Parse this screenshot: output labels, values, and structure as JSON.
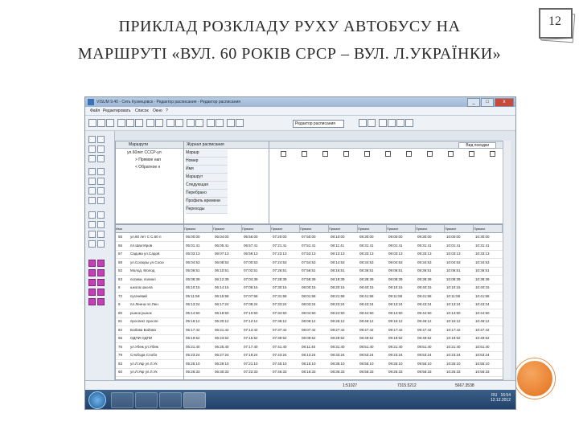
{
  "slide": {
    "title_line1": "ПРИКЛАД РОЗКЛАДУ РУХУ АВТОБУСУ НА",
    "title_line2": "МАРШРУТІ «ВУЛ. 60 РОКІВ СРСР – ВУЛ. Л.УКРАЇНКИ»",
    "page_number": "12"
  },
  "app": {
    "window_title": "VISUM 9.40 - Сеть Кузнецовск - Редактор расписания - Редактор расписания",
    "menu": [
      "Файл",
      "Редактировать",
      "Список",
      "Окно",
      "?"
    ],
    "toolbar_select": "Редактор расписания"
  },
  "tree": {
    "header": "Маршрути",
    "items": [
      "ул.60лет СССР-ул",
      "> Прямое нап",
      "< Обратное н"
    ]
  },
  "journal": {
    "header": "Журнал расписания",
    "rows": [
      "Маршр",
      "Номер",
      "Имя",
      "Маршрут",
      "Следующая",
      "Перебрано",
      "Профиль времени",
      "Переходы"
    ]
  },
  "top_grid": {
    "right_select": "Вид поездки"
  },
  "table": {
    "headers": [
      "Имя",
      "Прямое",
      "Прямое",
      "Прямое",
      "Прямое",
      "Прямое",
      "Прямое",
      "Прямое",
      "Прямое",
      "Прямое",
      "Прямое",
      "Прямое"
    ],
    "left_rows": [
      [
        "55",
        "ул.60 лет С С.60 л"
      ],
      [
        "56",
        "пл.Шахтёров"
      ],
      [
        "57",
        "Садова ул.Садов"
      ],
      [
        "58",
        "ул.Сосюры ул.Сосю"
      ],
      [
        "52",
        "Молод. Молод"
      ],
      [
        "53",
        "полики. поликл"
      ],
      [
        "8",
        "школа школа"
      ],
      [
        "72",
        "пугачевий"
      ],
      [
        "9",
        "пл.Ленна пл.Лен"
      ],
      [
        "80",
        "рынок рынок"
      ],
      [
        "81",
        "проспект проспе"
      ],
      [
        "82",
        "Бойова Бойова"
      ],
      [
        "55",
        "ОДПИ ОДПИ"
      ],
      [
        "76",
        "ул.Убеж ул.Убеж"
      ],
      [
        "79",
        "Слобода Слобо"
      ],
      [
        "83",
        "ул.Л.Укр ул.Л.Ук"
      ],
      [
        "60",
        "ул.Л.Укр ул.Л.Ук"
      ]
    ],
    "rows": [
      [
        "05:00:00",
        "06:04:00",
        "06:56:00",
        "07:20:00",
        "07:50:00",
        "08:10:00",
        "08:30:00",
        "09:00:00",
        "09:30:00",
        "10:00:00",
        "10:30:00"
      ],
      [
        "05:01:41",
        "06:05:41",
        "06:57:41",
        "07:21:41",
        "07:51:41",
        "08:11:41",
        "08:31:41",
        "09:01:41",
        "09:31:41",
        "10:01:41",
        "10:31:41"
      ],
      [
        "05:03:13",
        "06:07:13",
        "06:59:13",
        "07:23:13",
        "07:53:13",
        "08:13:13",
        "08:33:13",
        "09:03:13",
        "09:33:13",
        "10:03:13",
        "10:33:13"
      ],
      [
        "05:04:53",
        "06:08:53",
        "07:00:53",
        "07:24:53",
        "07:54:53",
        "08:14:53",
        "08:34:53",
        "09:04:53",
        "09:34:53",
        "10:04:53",
        "10:34:53"
      ],
      [
        "05:06:51",
        "06:10:51",
        "07:02:51",
        "07:26:51",
        "07:56:51",
        "08:16:51",
        "08:36:51",
        "09:06:51",
        "09:36:51",
        "10:06:51",
        "10:36:51"
      ],
      [
        "05:08:39",
        "06:12:39",
        "07:04:39",
        "07:28:39",
        "07:58:39",
        "08:18:39",
        "08:38:39",
        "09:08:39",
        "09:38:39",
        "10:08:39",
        "10:38:39"
      ],
      [
        "05:10:15",
        "06:14:15",
        "07:06:15",
        "07:30:15",
        "08:00:15",
        "08:20:15",
        "08:40:15",
        "09:10:15",
        "09:40:15",
        "10:10:15",
        "10:40:15"
      ],
      [
        "05:11:58",
        "06:15:58",
        "07:07:58",
        "07:31:58",
        "08:01:58",
        "08:21:58",
        "08:41:58",
        "09:11:58",
        "09:41:58",
        "10:11:58",
        "10:41:58"
      ],
      [
        "05:13:24",
        "06:17:24",
        "07:09:24",
        "07:33:24",
        "08:03:24",
        "08:23:24",
        "08:43:24",
        "09:13:24",
        "09:43:24",
        "10:13:24",
        "10:43:24"
      ],
      [
        "05:14:50",
        "06:18:50",
        "07:10:50",
        "07:34:50",
        "08:04:50",
        "08:24:50",
        "08:44:50",
        "09:14:50",
        "09:44:50",
        "10:14:50",
        "10:44:50"
      ],
      [
        "05:16:12",
        "06:20:12",
        "07:12:12",
        "07:36:12",
        "08:06:12",
        "08:26:12",
        "08:46:12",
        "09:16:12",
        "09:46:12",
        "10:16:12",
        "10:46:12"
      ],
      [
        "05:17:42",
        "06:21:42",
        "07:13:42",
        "07:37:42",
        "08:07:42",
        "08:27:42",
        "08:47:42",
        "09:17:42",
        "09:47:42",
        "10:17:42",
        "10:47:42"
      ],
      [
        "05:19:52",
        "06:23:52",
        "07:15:52",
        "07:39:52",
        "08:09:52",
        "08:29:52",
        "08:49:52",
        "09:19:52",
        "09:49:52",
        "10:19:52",
        "10:49:52"
      ],
      [
        "05:21:40",
        "06:25:40",
        "07:17:40",
        "07:41:40",
        "08:11:40",
        "08:31:40",
        "08:51:40",
        "09:21:40",
        "09:51:40",
        "10:21:40",
        "10:51:40"
      ],
      [
        "05:23:24",
        "06:27:24",
        "07:19:24",
        "07:43:24",
        "08:13:24",
        "08:33:24",
        "08:53:24",
        "09:23:24",
        "09:53:24",
        "10:23:24",
        "10:53:24"
      ],
      [
        "05:25:10",
        "06:29:10",
        "07:21:10",
        "07:45:10",
        "08:15:10",
        "08:35:10",
        "08:55:10",
        "09:25:10",
        "09:55:10",
        "10:25:10",
        "10:55:10"
      ],
      [
        "05:26:33",
        "06:30:33",
        "07:22:33",
        "07:46:33",
        "08:16:33",
        "08:36:33",
        "08:56:33",
        "09:26:33",
        "09:56:33",
        "10:26:33",
        "10:56:33"
      ]
    ]
  },
  "status": {
    "scale": "1:51027",
    "coord_x": "7315.5212",
    "coord_y": "5667.3538"
  },
  "taskbar": {
    "lang": "RU",
    "time": "16:54",
    "date": "12.12.2012"
  },
  "colors": {
    "accent_orange": "#e2701c",
    "magenta_tool": "#c53fb9",
    "taskbar": "#22416a"
  }
}
